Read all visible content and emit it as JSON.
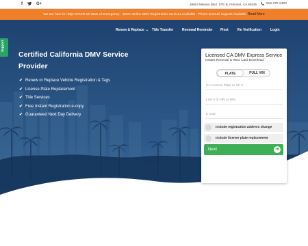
{
  "topbar": {
    "social_icons": [
      "facebook-icon",
      "twitter-icon",
      "google-plus-icon"
    ],
    "social_glyphs": [
      "f",
      "▾",
      "G+"
    ],
    "address": "38603 Mission Blvd. STE B, Fremont, CA 94536",
    "phone": "916-270-6400"
  },
  "alert": {
    "text": "We are here to Help! COVID-19 State of Emergency - 100% Online DMV Registration Services Available - Phone & Email Support Available",
    "link_label": "Read More"
  },
  "nav": {
    "items": [
      {
        "label": "Renew & Replace",
        "dropdown": true
      },
      {
        "label": "Title Transfer"
      },
      {
        "label": "Renewal Reminder"
      },
      {
        "label": "Fleet"
      },
      {
        "label": "Vin Verification"
      },
      {
        "label": "Login"
      }
    ]
  },
  "support_tab": {
    "label": "Support"
  },
  "hero": {
    "title": "Certified California DMV Service Provider",
    "features": [
      "Renew or Replace Vehicle Registration & Tags",
      "License Plate Replacement",
      "Title Services",
      "Free Instant Registration e-copy",
      "Guaranteed Next Day Delivery"
    ]
  },
  "form": {
    "title": "Licensed CA DMV Express Service",
    "subtitle": "Instant Renewal & REG Card Download",
    "toggle": {
      "active": "PLATE",
      "other": "FULL VIN"
    },
    "plate_placeholder": "CA License Plate or CF #",
    "vin_placeholder": "Last 3 of VIN or HIN",
    "email_placeholder": "E-mail",
    "options": [
      "Include registration address change",
      "Include license plate replacement"
    ],
    "next_label": "Next"
  },
  "colors": {
    "alert_bg": "#f07f2c",
    "hero_blue": "#27507f",
    "next_green": "#3fae57",
    "support_green": "#2aa36b"
  }
}
